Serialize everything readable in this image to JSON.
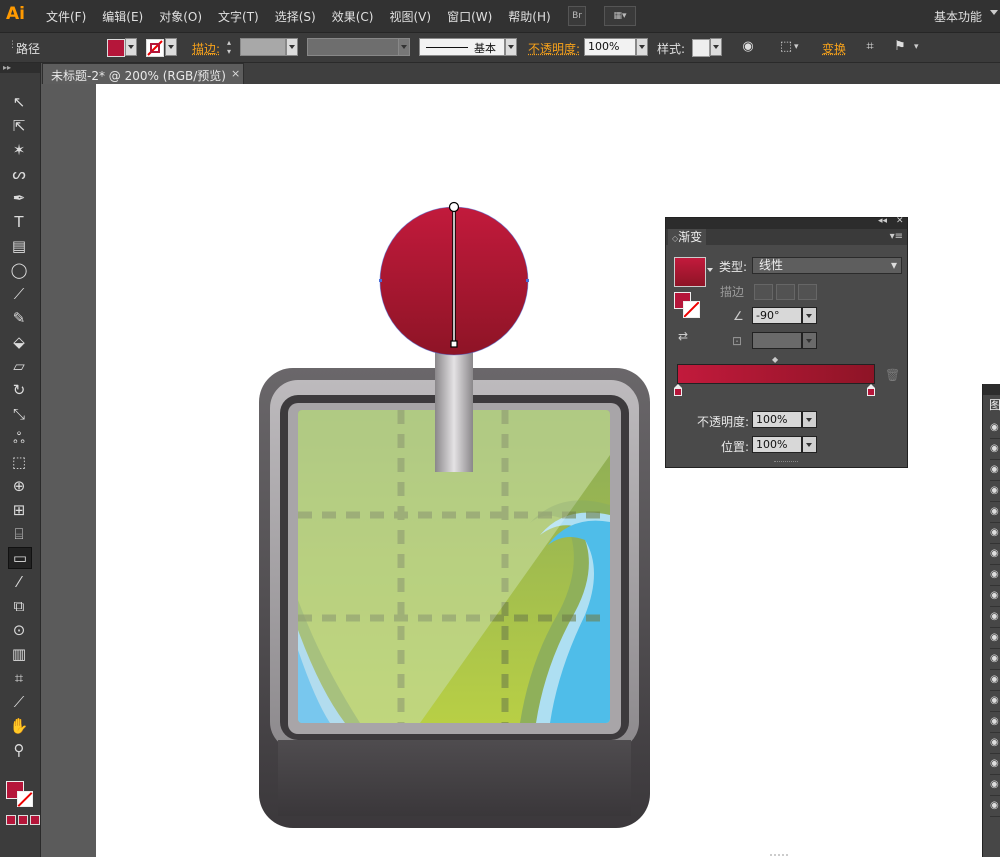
{
  "app": {
    "logo": "Ai"
  },
  "menu": [
    "文件(F)",
    "编辑(E)",
    "对象(O)",
    "文字(T)",
    "选择(S)",
    "效果(C)",
    "视图(V)",
    "窗口(W)",
    "帮助(H)"
  ],
  "menubar": {
    "bridge_label": "Br",
    "workspace": "基本功能"
  },
  "controlbar": {
    "selection_type": "路径",
    "stroke_label": "描边:",
    "brush_label": "基本",
    "opacity_label": "不透明度:",
    "opacity_value": "100%",
    "style_label": "样式:",
    "transform_label": "变换"
  },
  "document": {
    "tab_title": "未标题-2* @ 200% (RGB/预览)",
    "close": "×"
  },
  "gradient_panel": {
    "title": "渐变",
    "type_label": "类型:",
    "type_value": "线性",
    "stroke_label": "描边",
    "angle_value": "-90°",
    "opacity_label": "不透明度:",
    "opacity_value": "100%",
    "position_label": "位置:",
    "position_value": "100%",
    "start_color": "#c21a3c",
    "end_color": "#8e1426"
  },
  "layers_panel": {
    "tab_label": "图"
  },
  "colors": {
    "fill": "#b5163a",
    "ui_accent": "#f7a21b"
  }
}
